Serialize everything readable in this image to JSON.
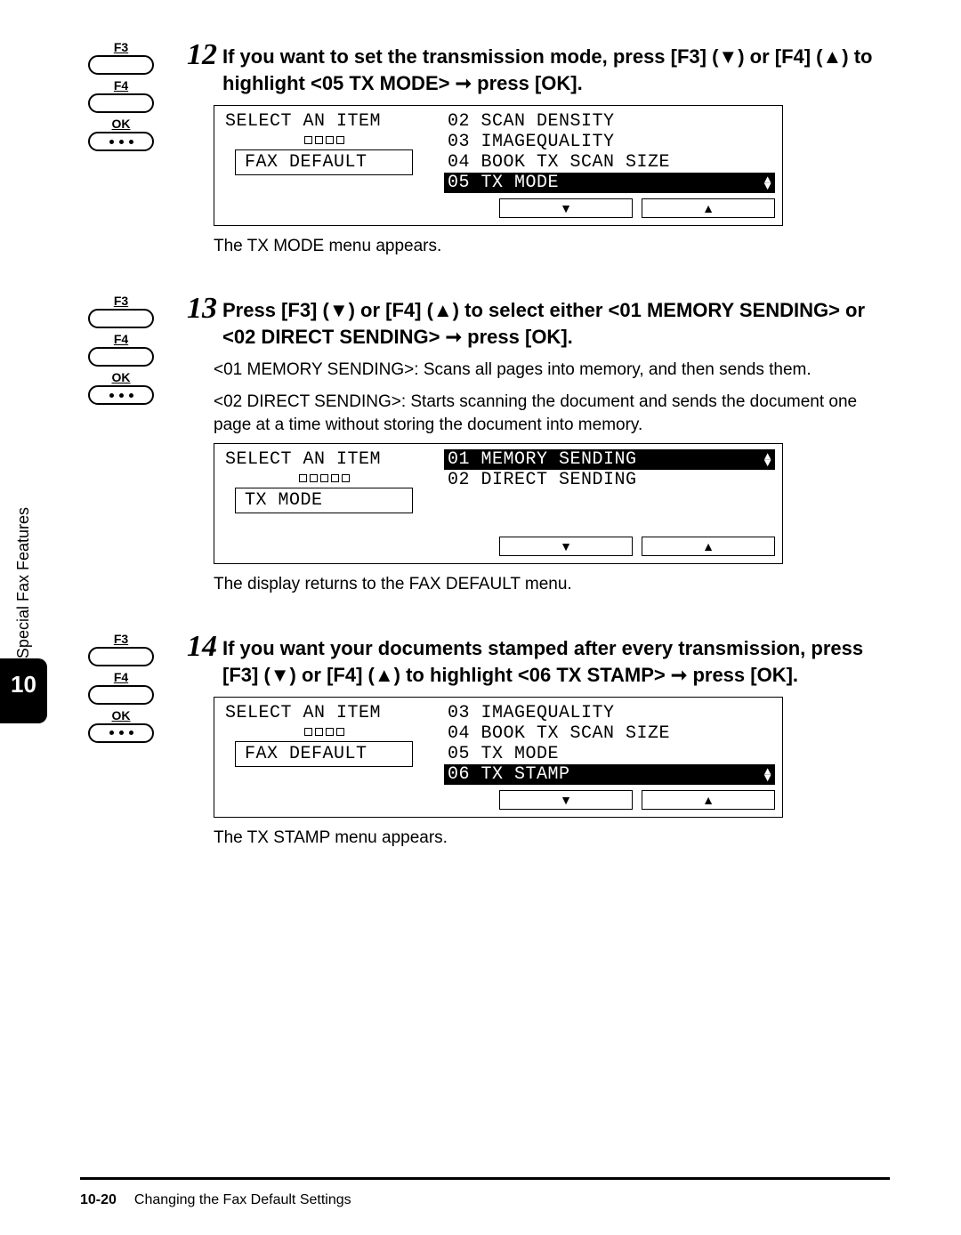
{
  "keys": {
    "f3": "F3",
    "f4": "F4",
    "ok": "OK"
  },
  "step12": {
    "num": "12",
    "heading": "If you want to set the transmission mode, press [F3] (▼) or [F4] (▲) to highlight <05 TX MODE> ➞ press [OK].",
    "lcd": {
      "left_title": "SELECT AN ITEM",
      "left_box": "FAX DEFAULT",
      "right": [
        "02 SCAN DENSITY",
        "03 IMAGEQUALITY",
        "04 BOOK TX SCAN SIZE"
      ],
      "right_sel": "05 TX MODE",
      "squares": 4
    },
    "caption": "The TX MODE menu appears."
  },
  "step13": {
    "num": "13",
    "heading": "Press [F3] (▼) or [F4] (▲) to select either <01 MEMORY SENDING> or <02 DIRECT SENDING> ➞ press [OK].",
    "desc1": "<01 MEMORY SENDING>: Scans all pages into memory, and then sends them.",
    "desc2": "<02 DIRECT SENDING>: Starts scanning the document and sends the document one page at a time without storing the document into memory.",
    "lcd": {
      "left_title": "SELECT AN ITEM",
      "left_box": "TX MODE",
      "right_sel": "01 MEMORY SENDING",
      "right": [
        "02 DIRECT SENDING"
      ],
      "squares": 5
    },
    "caption": "The display returns to the FAX DEFAULT menu."
  },
  "step14": {
    "num": "14",
    "heading": "If you want your documents stamped after every transmission, press [F3] (▼) or [F4] (▲) to highlight <06 TX STAMP> ➞ press [OK].",
    "lcd": {
      "left_title": "SELECT AN ITEM",
      "left_box": "FAX DEFAULT",
      "right": [
        "03 IMAGEQUALITY",
        "04 BOOK TX SCAN SIZE",
        "05 TX MODE"
      ],
      "right_sel": "06 TX STAMP",
      "squares": 4
    },
    "caption": "The TX STAMP menu appears."
  },
  "side": {
    "text": "Special Fax Features",
    "badge": "10"
  },
  "footer": {
    "page": "10-20",
    "title": "Changing the Fax Default Settings"
  },
  "glyphs": {
    "down": "▼",
    "up": "▲"
  }
}
